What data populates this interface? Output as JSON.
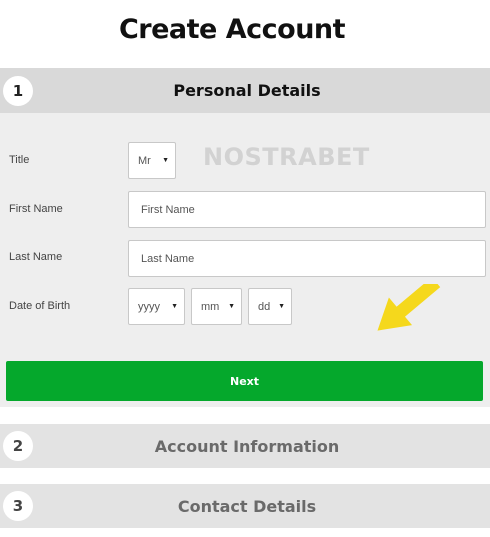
{
  "page": {
    "title": "Create Account"
  },
  "steps": [
    {
      "number": "1",
      "title": "Personal Details"
    },
    {
      "number": "2",
      "title": "Account Information"
    },
    {
      "number": "3",
      "title": "Contact Details"
    }
  ],
  "watermark": "NOSTRABET",
  "form": {
    "title": {
      "label": "Title",
      "selected": "Mr"
    },
    "first_name": {
      "label": "First Name",
      "placeholder": "First Name"
    },
    "last_name": {
      "label": "Last Name",
      "placeholder": "Last Name"
    },
    "dob": {
      "label": "Date of Birth",
      "year": "yyyy",
      "month": "mm",
      "day": "dd"
    },
    "next_label": "Next"
  },
  "colors": {
    "primary_button": "#05a82c",
    "arrow": "#f5d81c"
  }
}
